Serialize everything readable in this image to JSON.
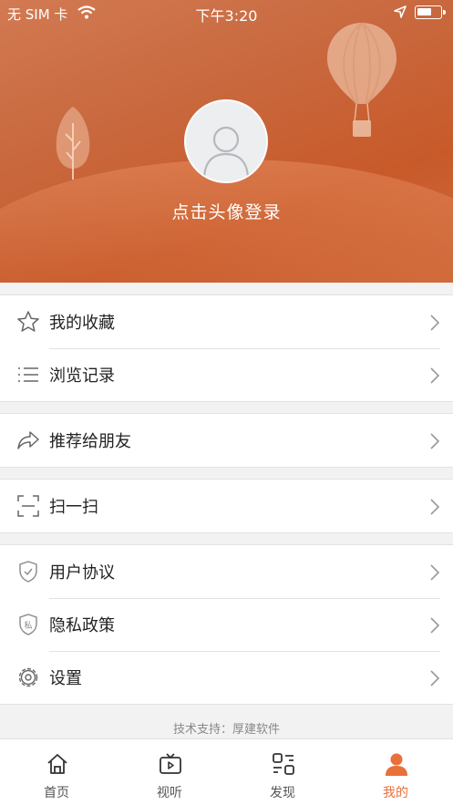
{
  "status_bar": {
    "carrier": "无 SIM 卡",
    "time": "下午3:20"
  },
  "profile": {
    "login_prompt": "点击头像登录"
  },
  "menu": {
    "favorites": "我的收藏",
    "history": "浏览记录",
    "recommend": "推荐给朋友",
    "scan": "扫一扫",
    "agreement": "用户协议",
    "privacy": "隐私政策",
    "settings": "设置"
  },
  "footer": {
    "support": "技术支持：厚建软件"
  },
  "tabs": {
    "home": "首页",
    "media": "视听",
    "discover": "发现",
    "mine": "我的"
  },
  "colors": {
    "accent": "#e8703a",
    "hero": "#c85a2a"
  },
  "icons": [
    "star-icon",
    "list-icon",
    "share-icon",
    "scan-icon",
    "shield-check-icon",
    "shield-private-icon",
    "gear-icon",
    "home-icon",
    "tv-icon",
    "discover-icon",
    "user-icon",
    "chevron-right-icon"
  ]
}
